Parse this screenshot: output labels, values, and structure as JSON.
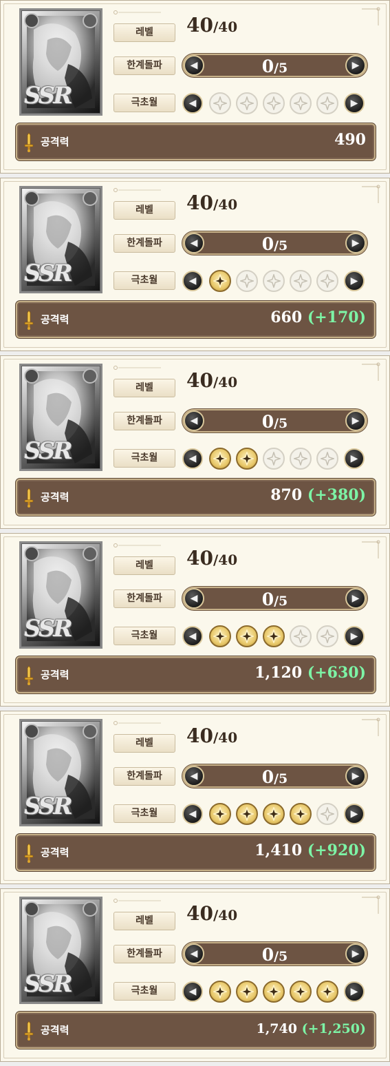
{
  "labels": {
    "level": "레벨",
    "limit_break": "한계돌파",
    "ascension": "극초월",
    "attack": "공격력"
  },
  "rarity": "SSR",
  "colors": {
    "panel_bg": "#fbf8ec",
    "bar_brown": "#6d5443",
    "bonus_green": "#7df4a6",
    "gold": "#e8c86a"
  },
  "icons": [
    "sword-icon",
    "arrow-left-icon",
    "arrow-right-icon",
    "ascension-star-icon"
  ],
  "rows": [
    {
      "level": "40",
      "level_max": "/40",
      "limit": "0",
      "limit_max": "/5",
      "stars_filled": 0,
      "attack": "490",
      "bonus": ""
    },
    {
      "level": "40",
      "level_max": "/40",
      "limit": "0",
      "limit_max": "/5",
      "stars_filled": 1,
      "attack": "660",
      "bonus": "(+170)"
    },
    {
      "level": "40",
      "level_max": "/40",
      "limit": "0",
      "limit_max": "/5",
      "stars_filled": 2,
      "attack": "870",
      "bonus": "(+380)"
    },
    {
      "level": "40",
      "level_max": "/40",
      "limit": "0",
      "limit_max": "/5",
      "stars_filled": 3,
      "attack": "1,120",
      "bonus": "(+630)"
    },
    {
      "level": "40",
      "level_max": "/40",
      "limit": "0",
      "limit_max": "/5",
      "stars_filled": 4,
      "attack": "1,410",
      "bonus": "(+920)"
    },
    {
      "level": "40",
      "level_max": "/40",
      "limit": "0",
      "limit_max": "/5",
      "stars_filled": 5,
      "attack": "1,740",
      "bonus": "(+1,250)"
    }
  ]
}
